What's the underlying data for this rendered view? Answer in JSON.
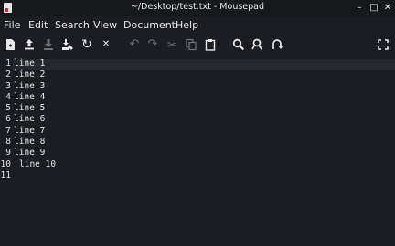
{
  "window": {
    "title": "~/Desktop/test.txt - Mousepad",
    "minimize_glyph": "–",
    "maximize_glyph": "□",
    "close_glyph": "✕"
  },
  "menu": [
    "File",
    "Edit",
    "Search",
    "View",
    "Document",
    "Help"
  ],
  "toolbar": {
    "reload_glyph": "↻",
    "close_glyph": "✕",
    "undo_glyph": "↶",
    "redo_glyph": "↷",
    "cut_glyph": "✂"
  },
  "editor": {
    "line_numbers": [
      "1",
      "2",
      "3",
      "4",
      "5",
      "6",
      "7",
      "8",
      "9",
      "10",
      "11"
    ],
    "lines": [
      "line 1",
      "line 2",
      "line 3",
      "line 4",
      "line 5",
      "line 6",
      "line 7",
      "line 8",
      "line 9",
      "line 10",
      ""
    ]
  },
  "colors": {
    "background": "#1b1d22",
    "current_line": "#25282d",
    "text": "#e8e8e8"
  }
}
